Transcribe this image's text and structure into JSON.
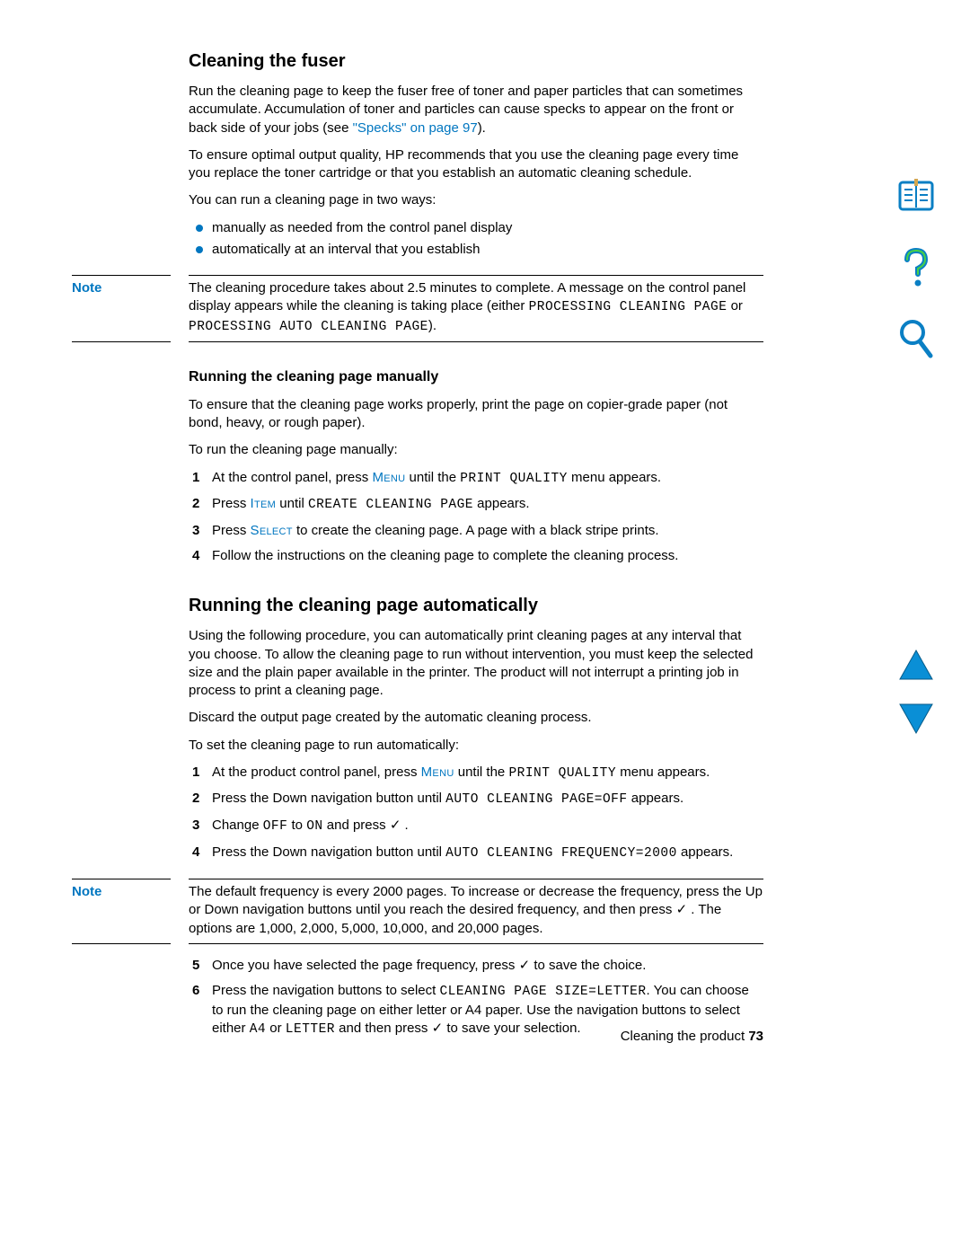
{
  "section1": {
    "title": "Cleaning the fuser",
    "para1_a": "Run the cleaning page to keep the fuser free of toner and paper particles that can sometimes accumulate. Accumulation of toner and particles can cause specks to appear on the front or back side of your jobs (see ",
    "para1_link": "\"Specks\" on page 97",
    "para1_c": ").",
    "para2": "To ensure optimal output quality, HP recommends that you use the cleaning page every time you replace the toner cartridge or that you establish an automatic cleaning schedule.",
    "para3": "You can run a cleaning page in two ways:",
    "bullets": [
      "manually as needed from the control panel display",
      "automatically at an interval that you establish"
    ]
  },
  "note1": {
    "label": "Note",
    "text_a": "The cleaning procedure takes about 2.5 minutes to complete. A message on the control panel display appears while the cleaning is taking place (either ",
    "text_mono1": "PROCESSING CLEANING PAGE",
    "text_b": " or ",
    "text_mono2": "PROCESSING AUTO CLEANING PAGE",
    "text_c": ")."
  },
  "subsection1": {
    "title": "Running the cleaning page manually",
    "para1": "To ensure that the cleaning page works properly, print the page on copier-grade paper (not bond, heavy, or rough paper).",
    "para2": "To run the cleaning page manually:",
    "steps": {
      "s1_a": "At the control panel, press ",
      "s1_sc": "Menu",
      "s1_b": " until the ",
      "s1_mono": "PRINT QUALITY",
      "s1_c": " menu appears.",
      "s2_a": "Press ",
      "s2_sc": "Item",
      "s2_b": " until ",
      "s2_mono": "CREATE CLEANING PAGE",
      "s2_c": " appears.",
      "s3_a": "Press ",
      "s3_sc": "Select",
      "s3_b": " to create the cleaning page. A page with a black stripe prints.",
      "s4": "Follow the instructions on the cleaning page to complete the cleaning process."
    }
  },
  "section2": {
    "title": "Running the cleaning page automatically",
    "para1": "Using the following procedure, you can automatically print cleaning pages at any interval that you choose. To allow the cleaning page to run without intervention, you must keep the selected size and the plain paper available in the printer. The product will not interrupt a printing job in process to print a cleaning page.",
    "para2": "Discard the output page created by the automatic cleaning process.",
    "para3": "To set the cleaning page to run automatically:",
    "steps": {
      "s1_a": "At the product control panel, press ",
      "s1_sc": "Menu",
      "s1_b": " until the ",
      "s1_mono": "PRINT QUALITY",
      "s1_c": " menu appears.",
      "s2_a": "Press the Down navigation button until ",
      "s2_mono": "AUTO CLEANING PAGE=OFF",
      "s2_b": " appears.",
      "s3_a": "Change ",
      "s3_mono1": "OFF",
      "s3_b": " to ",
      "s3_mono2": "ON",
      "s3_c": " and press ",
      "s3_d": " .",
      "s4_a": "Press the Down navigation button until ",
      "s4_mono": "AUTO CLEANING FREQUENCY=2000",
      "s4_b": " appears."
    }
  },
  "note2": {
    "label": "Note",
    "text_a": "The default frequency is every 2000 pages. To increase or decrease the frequency, press the Up or Down navigation buttons until you reach the desired frequency, and then press ",
    "text_b": " . The options are 1,000, 2,000, 5,000, 10,000, and 20,000 pages."
  },
  "steps_cont": {
    "s5_a": "Once you have selected the page frequency, press ",
    "s5_b": " to save the choice.",
    "s6_a": "Press the navigation buttons to select ",
    "s6_mono1": "CLEANING PAGE SIZE=LETTER",
    "s6_b": ". You can choose to run the cleaning page on either letter or A4 paper. Use the navigation buttons to select either ",
    "s6_mono2": "A4",
    "s6_c": " or ",
    "s6_mono3": "LETTER",
    "s6_d": " and then press ",
    "s6_e": " to save your selection."
  },
  "footer": {
    "text": "Cleaning the product",
    "page": "73"
  },
  "checkmark": "✓"
}
